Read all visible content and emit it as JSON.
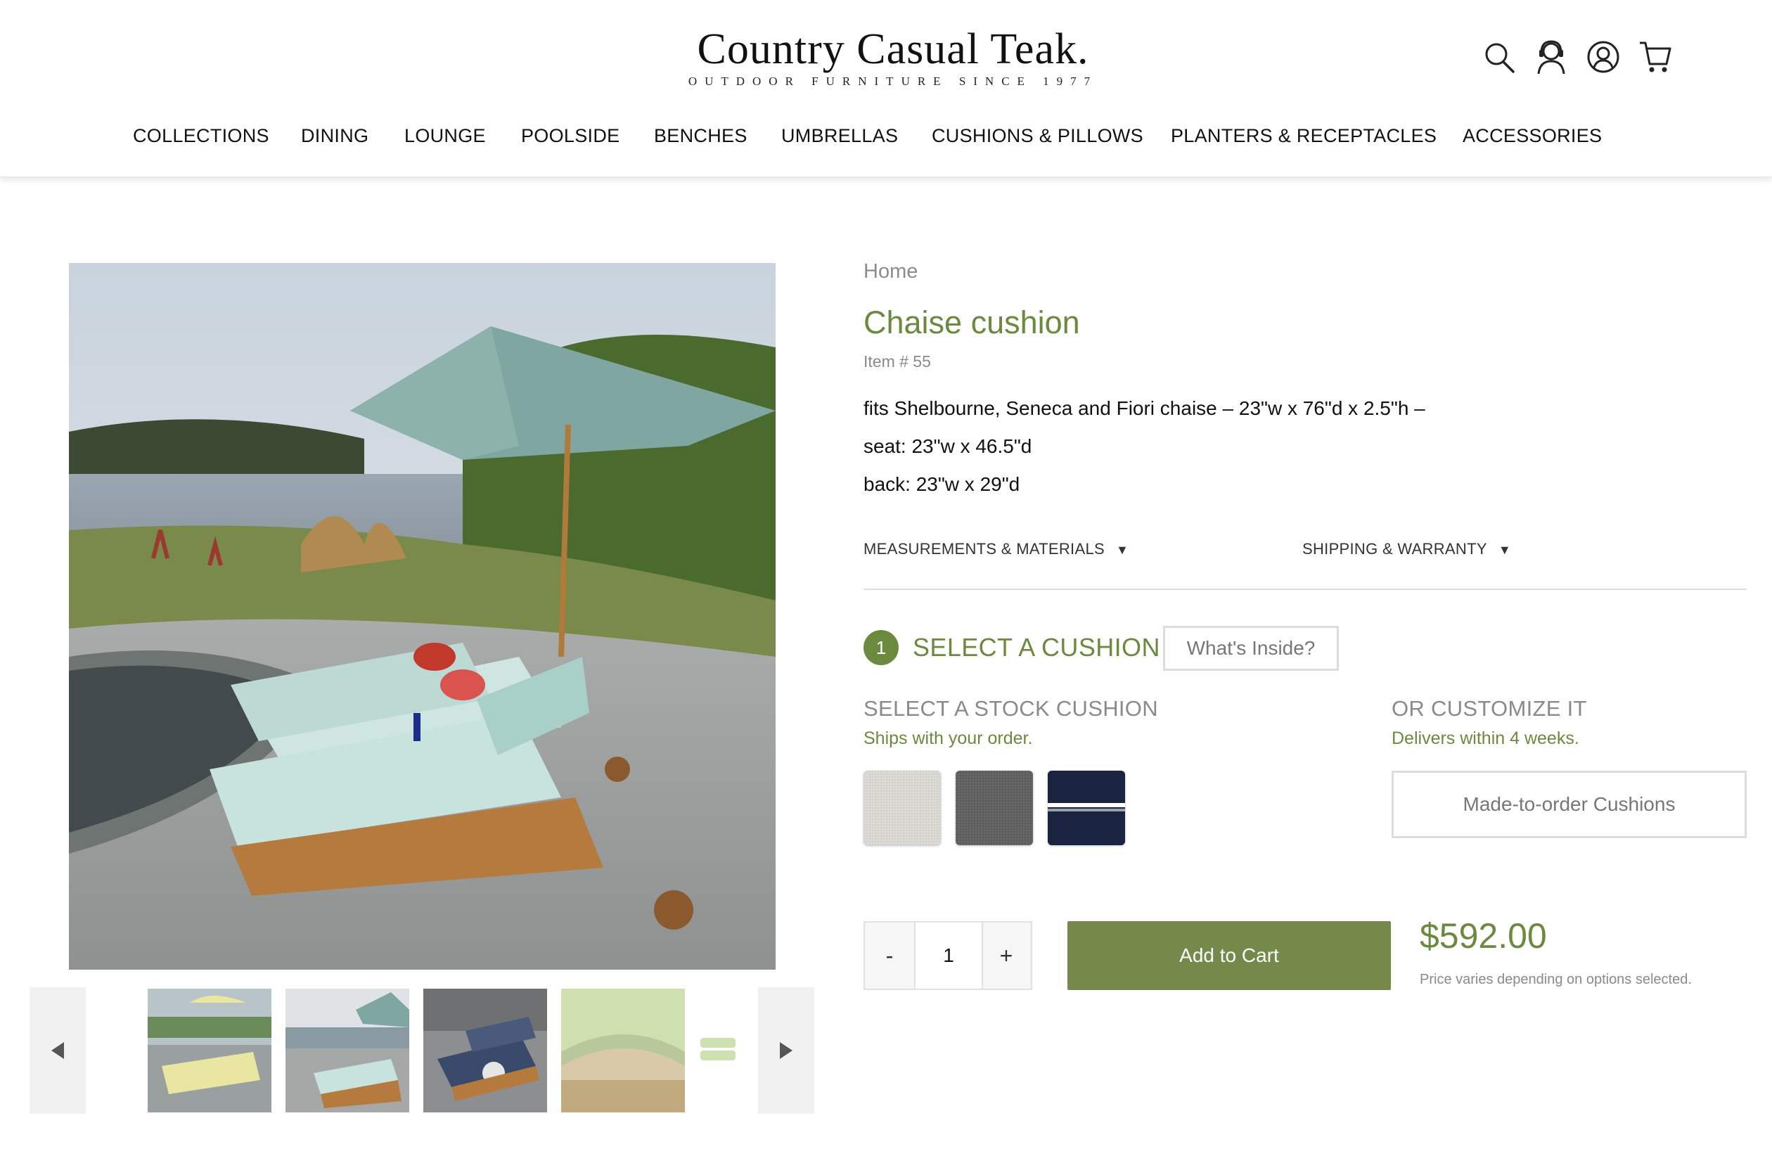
{
  "header": {
    "logo_title": "Country Casual Teak.",
    "logo_subtitle": "OUTDOOR FURNITURE SINCE 1977",
    "icons": [
      "search-icon",
      "support-agent-icon",
      "account-icon",
      "cart-icon"
    ]
  },
  "nav": {
    "items": [
      "COLLECTIONS",
      "DINING",
      "LOUNGE",
      "POOLSIDE",
      "BENCHES",
      "UMBRELLAS",
      "CUSHIONS & PILLOWS",
      "PLANTERS & RECEPTACLES",
      "ACCESSORIES"
    ]
  },
  "product": {
    "breadcrumb": "Home",
    "title": "Chaise cushion",
    "item_number": "Item # 55",
    "description": [
      "fits Shelbourne, Seneca and Fiori chaise – 23\"w x 76\"d x 2.5\"h –",
      "seat: 23\"w x 46.5\"d",
      "back: 23\"w x 29\"d"
    ],
    "tabs": [
      "MEASUREMENTS & MATERIALS",
      "SHIPPING & WARRANTY"
    ],
    "caret": "▼",
    "step_number": "1",
    "step_title": "SELECT A CUSHION",
    "whats_inside": "What's Inside?",
    "stock_label": "SELECT A STOCK CUSHION",
    "stock_sub": "Ships with your order.",
    "custom_label": "OR CUSTOMIZE IT",
    "custom_sub": "Delivers within 4 weeks.",
    "made_to_order": "Made-to-order Cushions",
    "swatches": [
      {
        "name": "light-grey-fabric",
        "color": "#dcdad6"
      },
      {
        "name": "charcoal-fabric",
        "color": "#5e5e5e"
      },
      {
        "name": "navy-white-stripe-fabric",
        "color": "#1a2340"
      }
    ],
    "qty_minus": "-",
    "qty_value": "1",
    "qty_plus": "+",
    "add_to_cart": "Add to Cart",
    "price": "$592.00",
    "price_note": "Price varies depending on options selected."
  },
  "gallery": {
    "thumbnail_count": 5
  },
  "colors": {
    "brand_green": "#6b8a3e",
    "button_green": "#758a4a"
  }
}
